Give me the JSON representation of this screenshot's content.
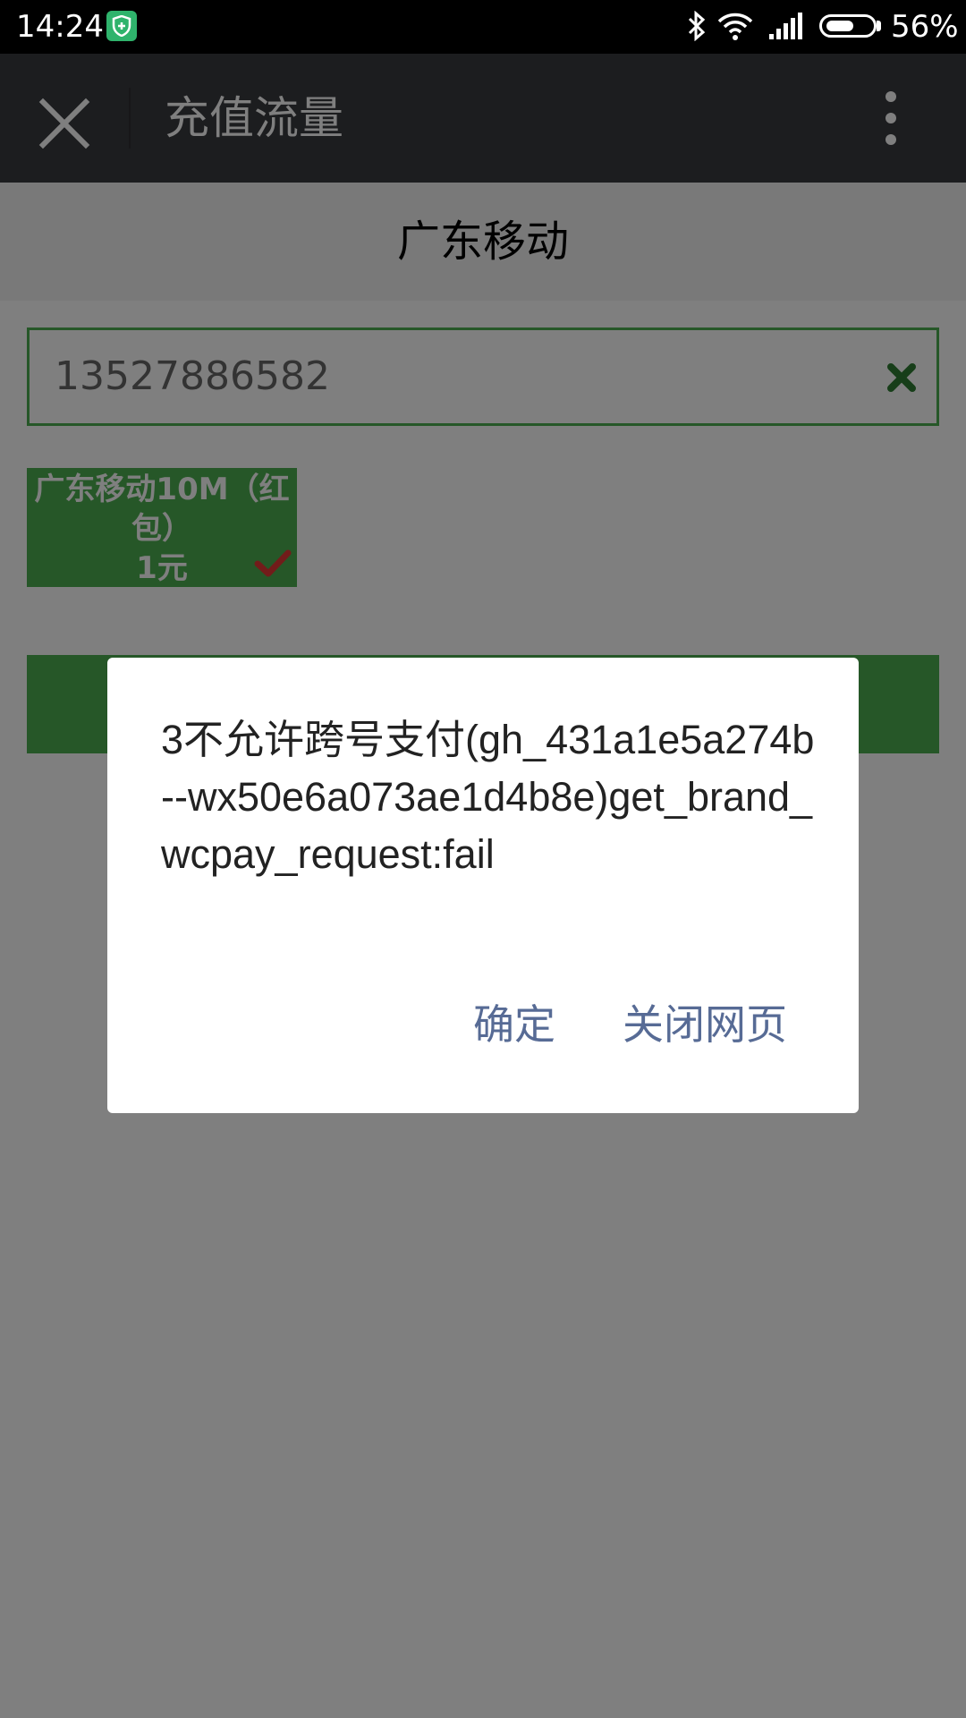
{
  "status_bar": {
    "time": "14:24",
    "battery_percent": "56%",
    "icons": [
      "shield-icon",
      "bluetooth-icon",
      "wifi-icon",
      "signal-icon",
      "battery-icon"
    ]
  },
  "toolbar": {
    "title": "充值流量",
    "close_icon": "close-icon",
    "more_icon": "more-vertical-icon"
  },
  "page": {
    "carrier": "广东移动",
    "phone_number": "13527886582",
    "package": {
      "name": "广东移动10M（红包）",
      "price": "1元",
      "selected": true
    }
  },
  "dialog": {
    "message": "3不允许跨号支付(gh_431a1e5a274b--wx50e6a073ae1d4b8e)get_brand_wcpay_request:fail",
    "ok_label": "确定",
    "close_page_label": "关闭网页"
  },
  "colors": {
    "accent_green": "#4caf50",
    "dialog_button_blue": "#576b95",
    "toolbar_bg": "#393a3e",
    "status_bar_bg": "#000000",
    "clear_icon_green": "#2e7d32",
    "check_red": "#e53935"
  }
}
